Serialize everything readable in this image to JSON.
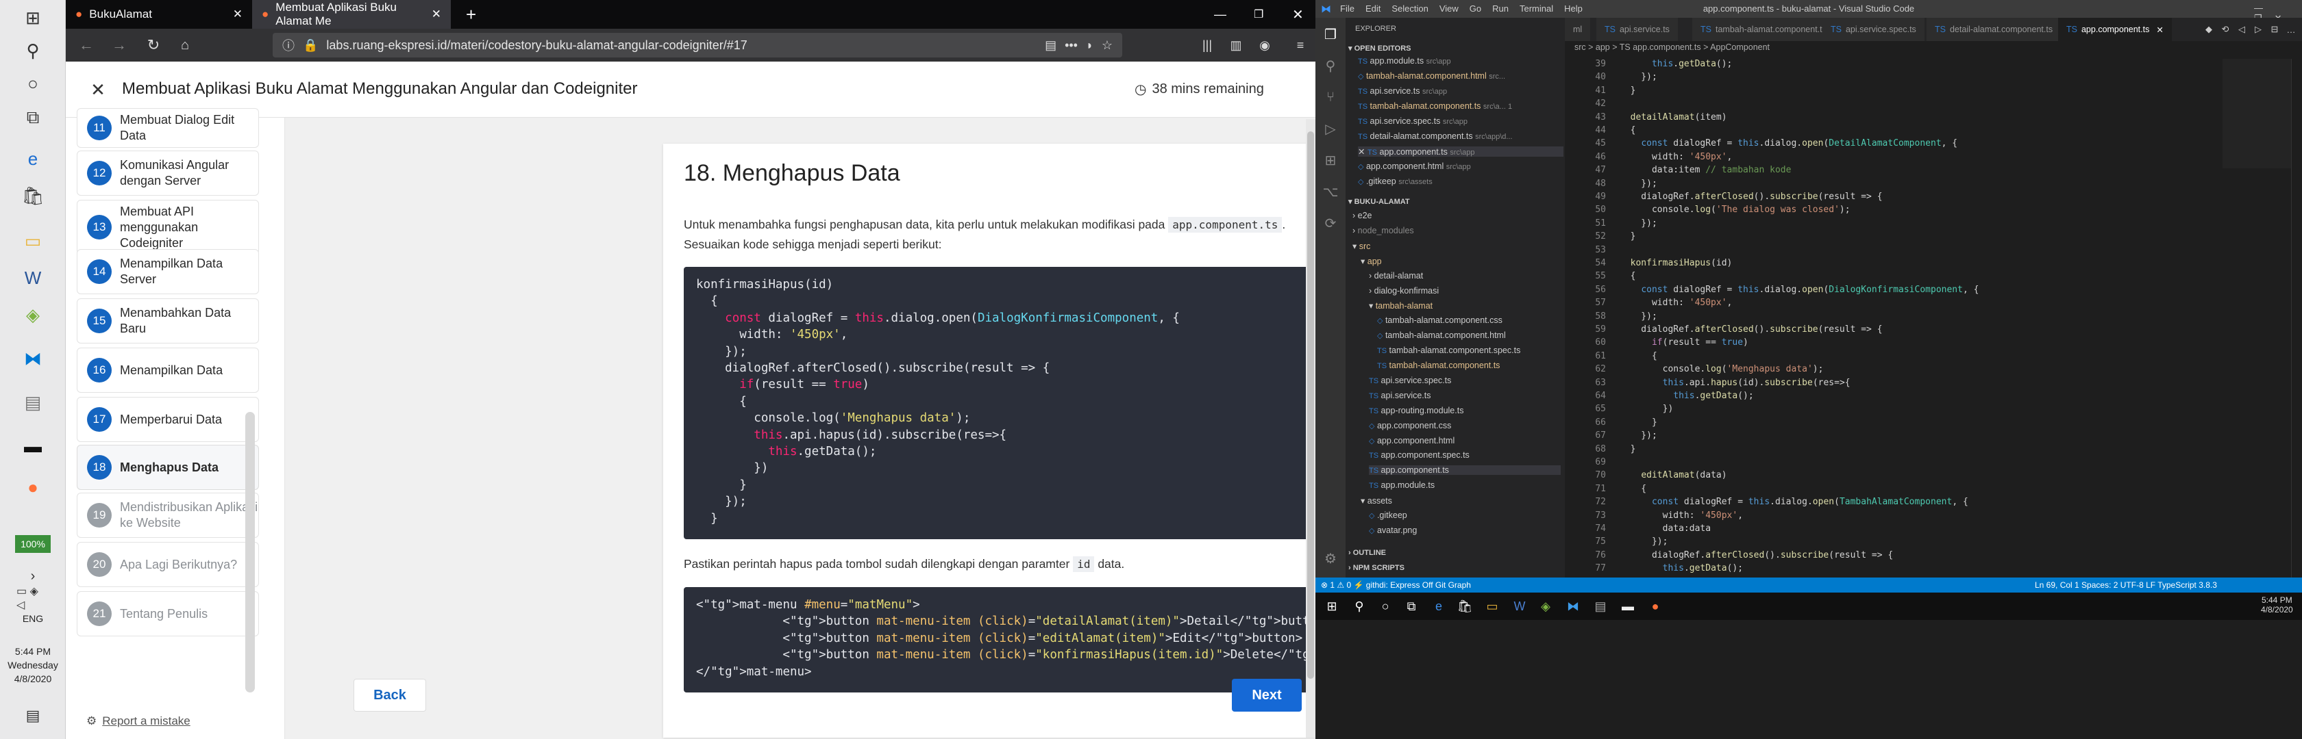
{
  "os_left": {
    "battery": "100%",
    "language": "ENG",
    "time": "5:44 PM",
    "day": "Wednesday",
    "date": "4/8/2020"
  },
  "firefox": {
    "tabs": [
      {
        "label": "BukuAlamat"
      },
      {
        "label": "Membuat Aplikasi Buku Alamat Me"
      }
    ],
    "url": "labs.ruang-ekspresi.id/materi/codestory-buku-alamat-angular-codeigniter/#17",
    "lesson_title": "Membuat Aplikasi Buku Alamat Menggunakan Angular dan Codeigniter",
    "remaining": "38 mins remaining"
  },
  "sidebar": {
    "items": [
      {
        "num": "11",
        "label": "Membuat Dialog Edit Data"
      },
      {
        "num": "12",
        "label": "Komunikasi Angular dengan Server"
      },
      {
        "num": "13",
        "label": "Membuat API menggunakan Codeigniter"
      },
      {
        "num": "14",
        "label": "Menampilkan Data Server"
      },
      {
        "num": "15",
        "label": "Menambahkan Data Baru"
      },
      {
        "num": "16",
        "label": "Menampilkan Data"
      },
      {
        "num": "17",
        "label": "Memperbarui Data"
      },
      {
        "num": "18",
        "label": "Menghapus Data"
      },
      {
        "num": "19",
        "label": "Mendistribusikan Aplikasi ke Website"
      },
      {
        "num": "20",
        "label": "Apa Lagi Berikutnya?"
      },
      {
        "num": "21",
        "label": "Tentang Penulis"
      }
    ],
    "report": "Report a mistake"
  },
  "article": {
    "heading": "18. Menghapus Data",
    "para1_a": "Untuk menambahka fungsi penghapusan data, kita perlu untuk melakukan modifikasi pada",
    "para1_code": "app.component.ts",
    "para1_b": "Sesuaikan kode sehigga menjadi seperti berikut:",
    "para2_a": "Pastikan perintah hapus pada tombol sudah dilengkapi dengan paramter",
    "para2_code": "id",
    "para2_b": "data.",
    "code1": [
      "konfirmasiHapus(id)",
      "  {",
      "    const dialogRef = this.dialog.open(DialogKonfirmasiComponent, {",
      "      width: '450px',",
      "    });",
      "    dialogRef.afterClosed().subscribe(result => {",
      "      if(result == true)",
      "      {",
      "        console.log('Menghapus data');",
      "        this.api.hapus(id).subscribe(res=>{",
      "          this.getData();",
      "        })",
      "      }",
      "    });",
      "  }"
    ],
    "code2": [
      "<mat-menu #menu=\"matMenu\">",
      "            <button mat-menu-item (click)=\"detailAlamat(item)\">Detail</button>",
      "            <button mat-menu-item (click)=\"editAlamat(item)\">Edit</button>",
      "            <button mat-menu-item (click)=\"konfirmasiHapus(item.id)\">Delete</button>",
      "</mat-menu>"
    ],
    "back": "Back",
    "next": "Next"
  },
  "vscode": {
    "title": "app.component.ts - buku-alamat - Visual Studio Code",
    "menu": [
      "File",
      "Edit",
      "Selection",
      "View",
      "Go",
      "Run",
      "Terminal",
      "Help"
    ],
    "tabs": [
      "ml",
      "api.service.ts",
      "tambah-alamat.component.ts",
      "api.service.spec.ts",
      "detail-alamat.component.ts",
      "app.component.ts"
    ],
    "breadcrumb": "src > app > TS app.component.ts > AppComponent",
    "explorer": "EXPLORER",
    "open_editors": "OPEN EDITORS",
    "open_files": [
      {
        "name": "app.module.ts",
        "path": "src\\app"
      },
      {
        "name": "tambah-alamat.component.html",
        "path": "src..."
      },
      {
        "name": "api.service.ts",
        "path": "src\\app"
      },
      {
        "name": "tambah-alamat.component.ts",
        "path": "src\\a...  1"
      },
      {
        "name": "api.service.spec.ts",
        "path": "src\\app"
      },
      {
        "name": "detail-alamat.component.ts",
        "path": "src\\app\\d..."
      },
      {
        "name": "app.component.ts",
        "path": "src\\app"
      },
      {
        "name": "app.component.html",
        "path": "src\\app"
      },
      {
        "name": ".gitkeep",
        "path": "src\\assets"
      }
    ],
    "project": "BUKU-ALAMAT",
    "tree": [
      "e2e",
      "node_modules",
      "src",
      "app",
      "detail-alamat",
      "dialog-konfirmasi",
      "tambah-alamat",
      "tambah-alamat.component.css",
      "tambah-alamat.component.html",
      "tambah-alamat.component.spec.ts",
      "tambah-alamat.component.ts",
      "api.service.spec.ts",
      "api.service.ts",
      "app-routing.module.ts",
      "app.component.css",
      "app.component.html",
      "app.component.spec.ts",
      "app.component.ts",
      "app.module.ts",
      "assets",
      ".gitkeep",
      "avatar.png"
    ],
    "outline": "OUTLINE",
    "npm": "NPM SCRIPTS",
    "line_numbers": [
      "39",
      "40",
      "41",
      "42",
      "43",
      "44",
      "45",
      "46",
      "47",
      "48",
      "49",
      "50",
      "51",
      "52",
      "53",
      "54",
      "55",
      "56",
      "57",
      "58",
      "59",
      "60",
      "61",
      "62",
      "63",
      "64",
      "65",
      "66",
      "67",
      "68",
      "69",
      "70",
      "71",
      "72",
      "73",
      "74",
      "75",
      "76",
      "77"
    ],
    "status_left": "⊗ 1 ⚠ 0   ⚡ githdi: Express Off   Git Graph",
    "status_right": "Ln 69, Col 1   Spaces: 2   UTF-8   LF   TypeScript   3.8.3",
    "taskbar_time": "5:44 PM",
    "taskbar_date": "4/8/2020"
  }
}
